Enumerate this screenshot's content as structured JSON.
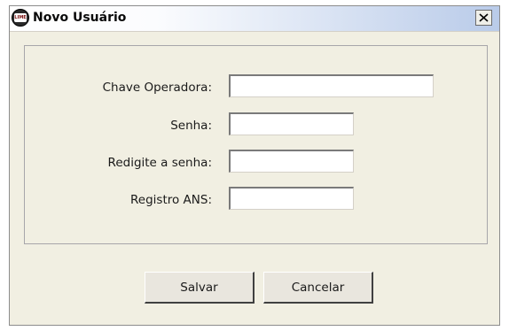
{
  "window": {
    "title": "Novo Usuário",
    "icon": "app-logo-icon",
    "icon_text": "LIME",
    "close_icon": "close-icon"
  },
  "form": {
    "fields": [
      {
        "label": "Chave Operadora:",
        "value": ""
      },
      {
        "label": "Senha:",
        "value": ""
      },
      {
        "label": "Redigite a senha:",
        "value": ""
      },
      {
        "label": "Registro ANS:",
        "value": ""
      }
    ]
  },
  "buttons": {
    "save_label": "Salvar",
    "cancel_label": "Cancelar"
  },
  "colors": {
    "dialog_background": "#f1efe2",
    "titlebar_gradient_end": "#b9cbe9",
    "input_background": "#ffffff"
  }
}
